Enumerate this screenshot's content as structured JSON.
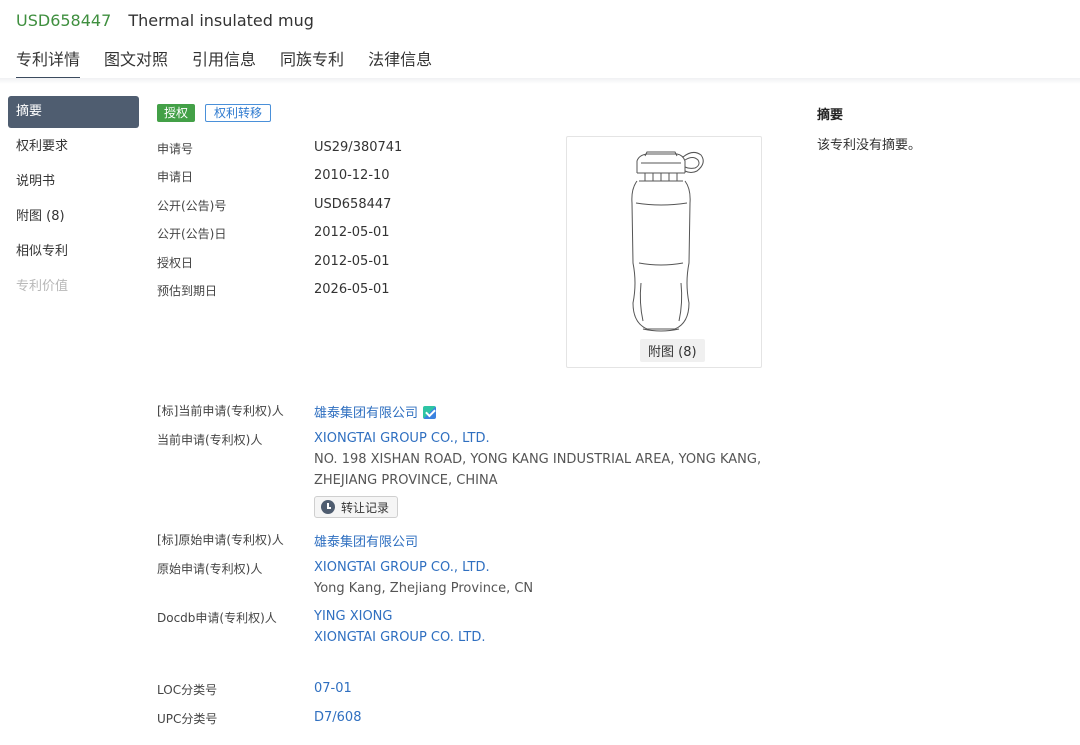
{
  "header": {
    "patent_number": "USD658447",
    "patent_title": "Thermal insulated mug",
    "tabs": [
      "专利详情",
      "图文对照",
      "引用信息",
      "同族专利",
      "法律信息"
    ]
  },
  "nav": {
    "items": [
      "摘要",
      "权利要求",
      "说明书",
      "附图 (8)",
      "相似专利",
      "专利价值"
    ]
  },
  "badges": {
    "status": "授权",
    "transfer": "权利转移"
  },
  "bib": [
    {
      "label": "申请号",
      "value": "US29/380741"
    },
    {
      "label": "申请日",
      "value": "2010-12-10"
    },
    {
      "label": "公开(公告)号",
      "value": "USD658447"
    },
    {
      "label": "公开(公告)日",
      "value": "2012-05-01"
    },
    {
      "label": "授权日",
      "value": "2012-05-01"
    },
    {
      "label": "预估到期日",
      "value": "2026-05-01"
    }
  ],
  "figure": {
    "caption": "附图 (8)"
  },
  "abstract": {
    "title": "摘要",
    "text": "该专利没有摘要。"
  },
  "applicants": {
    "std_current_label": "[标]当前申请(专利权)人",
    "std_current_value": "雄泰集团有限公司",
    "current_label": "当前申请(专利权)人",
    "current_name": "XIONGTAI GROUP CO., LTD.",
    "current_addr_1": "NO. 198 XISHAN ROAD, YONG KANG INDUSTRIAL AREA, YONG KANG,",
    "current_addr_2": "ZHEJIANG PROVINCE, CHINA",
    "transfer_button": "转让记录",
    "std_original_label": "[标]原始申请(专利权)人",
    "std_original_value": "雄泰集团有限公司",
    "original_label": "原始申请(专利权)人",
    "original_name": "XIONGTAI GROUP CO., LTD.",
    "original_addr": "Yong Kang, Zhejiang Province, CN",
    "docdb_label": "Docdb申请(专利权)人",
    "docdb_1": "YING XIONG",
    "docdb_2": "XIONGTAI GROUP CO. LTD."
  },
  "classification": {
    "loc_label": "LOC分类号",
    "loc_value": "07-01",
    "upc_label": "UPC分类号",
    "upc_value": "D7/608"
  }
}
